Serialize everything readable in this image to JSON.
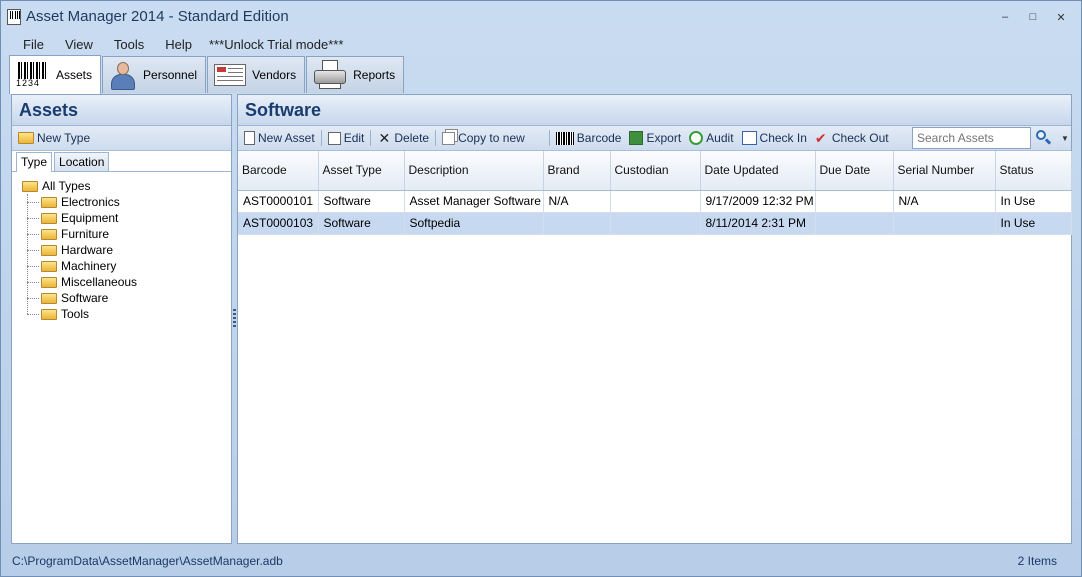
{
  "window": {
    "title": "Asset Manager 2014 - Standard Edition",
    "controls": [
      "–",
      "□",
      "✕"
    ]
  },
  "menu": [
    "File",
    "View",
    "Tools",
    "Help"
  ],
  "unlock_text": "***Unlock Trial mode***",
  "modules": {
    "barcode_digits": "1234",
    "tabs": [
      "Assets",
      "Personnel",
      "Vendors",
      "Reports"
    ]
  },
  "left_panel": {
    "title": "Assets",
    "new_type_label": "New Type",
    "tabs": [
      "Type",
      "Location"
    ],
    "tree": {
      "root": "All Types",
      "children": [
        "Electronics",
        "Equipment",
        "Furniture",
        "Hardware",
        "Machinery",
        "Miscellaneous",
        "Software",
        "Tools"
      ]
    }
  },
  "right_panel": {
    "title": "Software",
    "toolbar": {
      "new_asset": "New Asset",
      "edit": "Edit",
      "delete": "Delete",
      "copy_to_new": "Copy to new",
      "barcode": "Barcode",
      "export": "Export",
      "audit": "Audit",
      "check_in": "Check In",
      "check_out": "Check Out",
      "search_placeholder": "Search Assets"
    },
    "table": {
      "columns": [
        "Barcode",
        "Asset Type",
        "Description",
        "Brand",
        "Custodian",
        "Date Updated",
        "Due Date",
        "Serial Number",
        "Status"
      ],
      "rows": [
        [
          "AST0000101",
          "Software",
          "Asset Manager Software",
          "N/A",
          "",
          "9/17/2009 12:32 PM",
          "",
          "N/A",
          "In Use"
        ],
        [
          "AST0000103",
          "Software",
          "Softpedia",
          "",
          "",
          "8/11/2014 2:31 PM",
          "",
          "",
          "In Use"
        ]
      ],
      "selected_row": 1
    }
  },
  "status": {
    "path": "C:\\ProgramData\\AssetManager\\AssetManager.adb",
    "count": "2 Items"
  }
}
